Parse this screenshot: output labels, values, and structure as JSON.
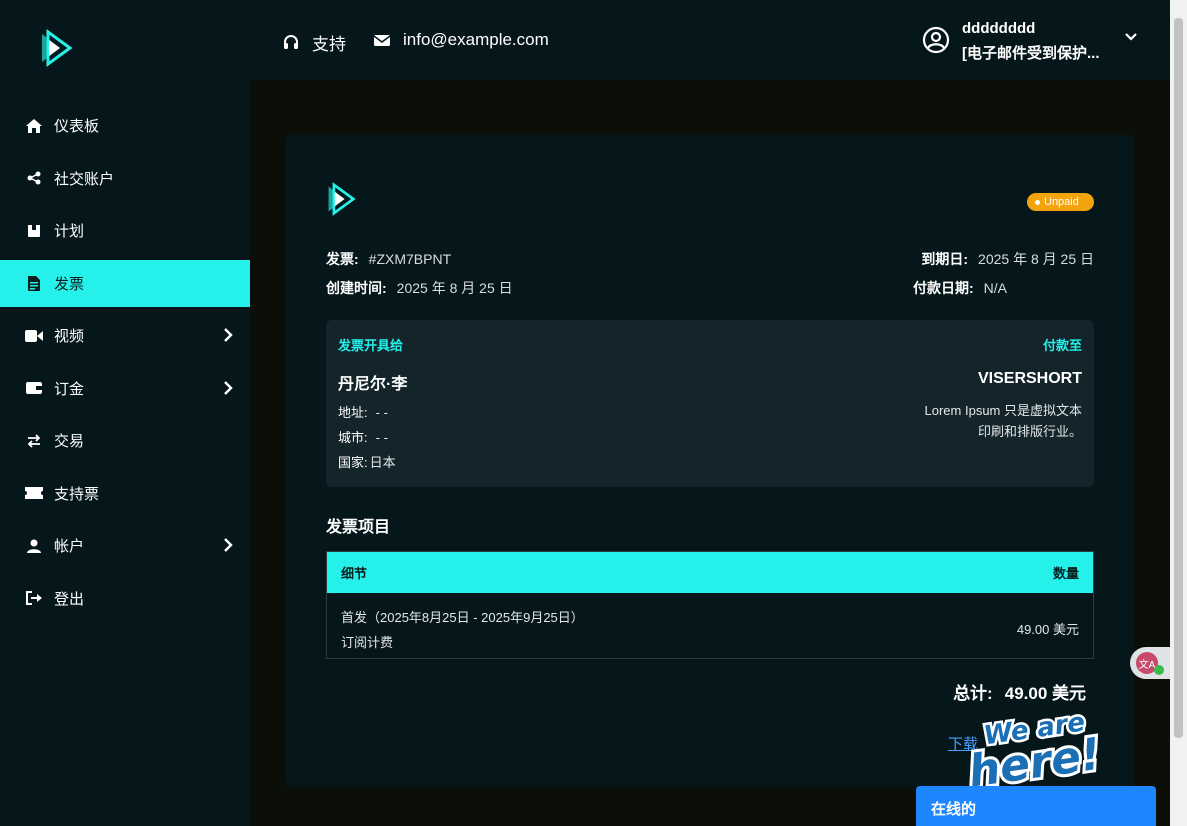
{
  "brand": {
    "accent": "#25f1ea",
    "sidebar_bg": "#06171b",
    "badge_color": "#f3a30c"
  },
  "sidebar": {
    "items": [
      {
        "label": "仪表板",
        "icon": "home-icon"
      },
      {
        "label": "社交账户",
        "icon": "share-icon"
      },
      {
        "label": "计划",
        "icon": "box-icon"
      },
      {
        "label": "发票",
        "icon": "file-invoice-icon",
        "active": true
      },
      {
        "label": "视频",
        "icon": "video-icon",
        "has_submenu": true
      },
      {
        "label": "订金",
        "icon": "wallet-icon",
        "has_submenu": true
      },
      {
        "label": "交易",
        "icon": "exchange-icon"
      },
      {
        "label": "支持票",
        "icon": "ticket-icon"
      },
      {
        "label": "帐户",
        "icon": "user-icon",
        "has_submenu": true
      },
      {
        "label": "登出",
        "icon": "logout-icon"
      }
    ]
  },
  "header": {
    "support_label": "支持",
    "email": "info@example.com",
    "user": {
      "name": "dddddddd",
      "email": "[电子邮件受到保护..."
    }
  },
  "invoice": {
    "status": "Unpaid",
    "number_label": "发票:",
    "number": "#ZXM7BPNT",
    "created_label": "创建时间:",
    "created": "2025 年 8 月 25 日",
    "due_label": "到期日:",
    "due": "2025 年 8 月 25 日",
    "paid_label": "付款日期:",
    "paid": "N/A",
    "bill_to_label": "发票开具给",
    "pay_to_label": "付款至",
    "customer": {
      "name": "丹尼尔·李",
      "address_label": "地址:",
      "address": "- -",
      "city_label": "城市:",
      "city": "- -",
      "country_label": "国家:",
      "country": "日本"
    },
    "company": {
      "name": "VISERSHORT",
      "desc_line1": "Lorem Ipsum 只是虚拟文本",
      "desc_line2": "印刷和排版行业。"
    },
    "items_title": "发票项目",
    "table": {
      "headers": [
        "细节",
        "数量"
      ],
      "rows": [
        {
          "line1": "首发（2025年8月25日 - 2025年9月25日）",
          "line2": "订阅计费",
          "amount": "49.00 美元"
        }
      ]
    },
    "total_label": "总计:",
    "total": "49.00 美元",
    "download_label": "下载"
  },
  "widgets": {
    "chat_status": "在线的",
    "chat_close": "×",
    "translate_icon": "translate-icon"
  }
}
